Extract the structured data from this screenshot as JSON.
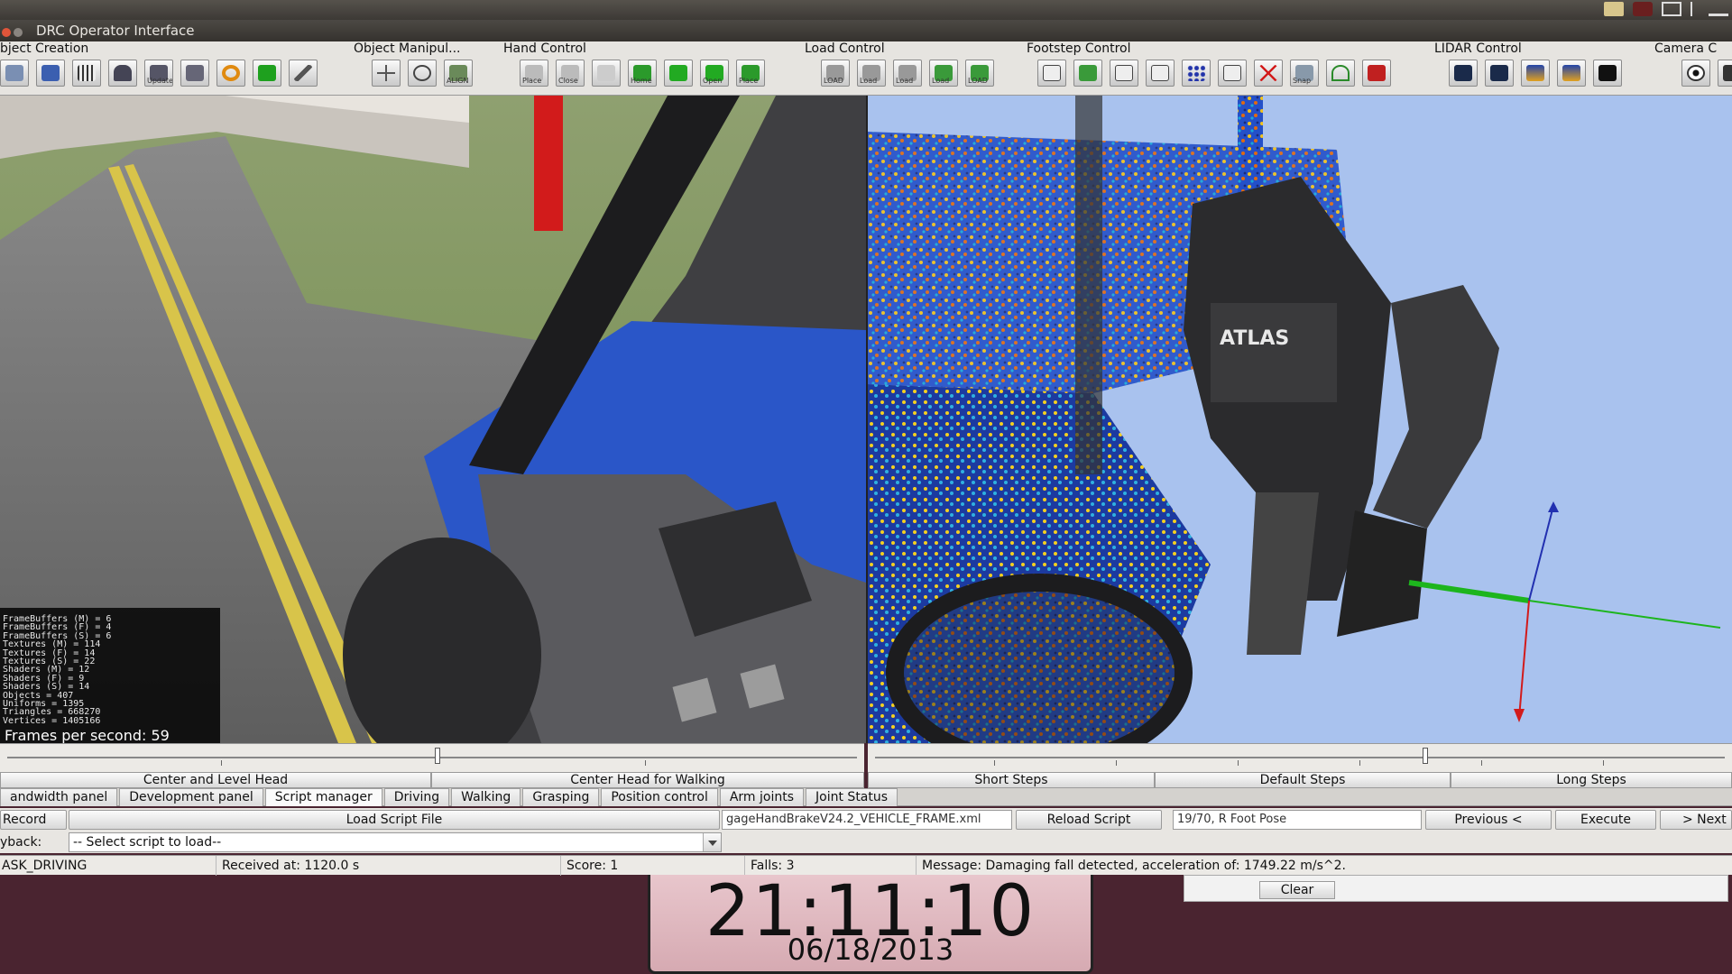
{
  "window": {
    "title": "DRC Operator Interface"
  },
  "toolbar": {
    "groups": [
      {
        "title": "bject Creation",
        "icons": [
          "scene-icon",
          "cube-icon",
          "grid-icon",
          "car-icon",
          "update-icon",
          "ring-icon",
          "box-icon",
          "drill-icon",
          "cutter-icon"
        ]
      },
      {
        "title": "Object Manipul...",
        "icons": [
          "move-icon",
          "rotate-icon",
          "align-icon"
        ]
      },
      {
        "title": "Hand Control",
        "icons": [
          "hand-place-icon",
          "hand-close-icon",
          "hand-blank-icon",
          "hand-home-icon",
          "hand-grasp-icon",
          "hand-open-icon",
          "hand-place2-icon"
        ]
      },
      {
        "title": "Load Control",
        "icons": [
          "load-icon",
          "load-a-icon",
          "load-b-icon",
          "load-c-icon",
          "load-d-icon"
        ]
      },
      {
        "title": "Footstep Control",
        "icons": [
          "foot-a-icon",
          "foot-b-icon",
          "foot-c-icon",
          "foot-d-icon",
          "foot-pattern-icon",
          "foot-e-icon",
          "foot-clear-icon",
          "snap-icon",
          "foot-turn-icon",
          "foot-stop-icon"
        ]
      },
      {
        "title": "LIDAR Control",
        "icons": [
          "lidar-a-icon",
          "lidar-b-icon",
          "lidar-c-icon",
          "lidar-d-icon",
          "lidar-off-icon"
        ]
      },
      {
        "title": "Camera C",
        "icons": [
          "eye-icon",
          "camera-icon"
        ]
      }
    ],
    "icon_text": {
      "update": "Update",
      "align": "ALIGN",
      "place": "Place",
      "close": "Close",
      "home": "Home",
      "open": "Open",
      "load": "LOAD",
      "load2": "Load",
      "snap": "Snap"
    }
  },
  "camera_stats": {
    "lines": [
      "FrameBuffers (M) = 6",
      "FrameBuffers (F) = 4",
      "FrameBuffers (S) = 6",
      "Textures (M) = 114",
      "Textures (F) = 14",
      "Textures (S) = 22",
      "Shaders (M) = 12",
      "Shaders (F) = 9",
      "Shaders (S) = 14",
      "Objects = 407",
      "Uniforms = 1395",
      "Triangles = 668270",
      "Vertices = 1405166"
    ],
    "fps": "Frames per second: 59"
  },
  "robot_label": "ATLAS",
  "head_buttons": {
    "center_level": "Center and Level Head",
    "center_walking": "Center Head for Walking"
  },
  "step_buttons": {
    "short": "Short Steps",
    "default": "Default Steps",
    "long": "Long Steps"
  },
  "tabs": [
    {
      "label": "andwidth panel",
      "active": false
    },
    {
      "label": "Development panel",
      "active": false
    },
    {
      "label": "Script manager",
      "active": true
    },
    {
      "label": "Driving",
      "active": false
    },
    {
      "label": "Walking",
      "active": false
    },
    {
      "label": "Grasping",
      "active": false
    },
    {
      "label": "Position control",
      "active": false
    },
    {
      "label": "Arm joints",
      "active": false
    },
    {
      "label": "Joint Status",
      "active": false
    }
  ],
  "script": {
    "record_label": "Record",
    "load_button": "Load Script File",
    "file_field": "gageHandBrakeV24.2_VEHICLE_FRAME.xml",
    "reload_button": "Reload Script",
    "step_field": "19/70, R Foot Pose",
    "previous_button": "Previous <",
    "execute_button": "Execute",
    "next_button": "> Next",
    "playback_label": "yback:",
    "select_value": "-- Select script to load--"
  },
  "status": {
    "task": "ASK_DRIVING",
    "received": "Received at:  1120.0 s",
    "score": "Score:  1",
    "falls": "Falls:  3",
    "message": "Message:  Damaging fall detected, acceleration of: 1749.22 m/s^2."
  },
  "clear_button": "Clear",
  "clock": {
    "time": "21:11:10",
    "date": "06/18/2013"
  },
  "colors": {
    "accent_red": "#d21b1b",
    "vehicle_blue": "#2a56c8",
    "lidar_bg": "#a9c2ee"
  }
}
